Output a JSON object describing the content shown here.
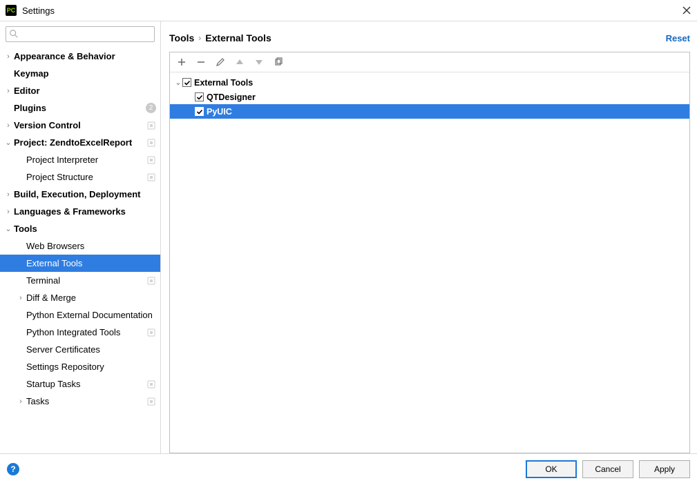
{
  "titlebar": {
    "title": "Settings"
  },
  "search": {
    "placeholder": ""
  },
  "sidebar": {
    "items": [
      {
        "label": "Appearance & Behavior",
        "bold": true,
        "arrow": "›",
        "indent": 0
      },
      {
        "label": "Keymap",
        "bold": true,
        "arrow": "",
        "indent": 0
      },
      {
        "label": "Editor",
        "bold": true,
        "arrow": "›",
        "indent": 0
      },
      {
        "label": "Plugins",
        "bold": true,
        "arrow": "",
        "indent": 0,
        "badge": "2"
      },
      {
        "label": "Version Control",
        "bold": true,
        "arrow": "›",
        "indent": 0,
        "cfg": true
      },
      {
        "label": "Project: ZendtoExcelReport",
        "bold": true,
        "arrow": "⌄",
        "indent": 0,
        "cfg": true
      },
      {
        "label": "Project Interpreter",
        "bold": false,
        "arrow": "",
        "indent": 1,
        "cfg": true
      },
      {
        "label": "Project Structure",
        "bold": false,
        "arrow": "",
        "indent": 1,
        "cfg": true
      },
      {
        "label": "Build, Execution, Deployment",
        "bold": true,
        "arrow": "›",
        "indent": 0
      },
      {
        "label": "Languages & Frameworks",
        "bold": true,
        "arrow": "›",
        "indent": 0
      },
      {
        "label": "Tools",
        "bold": true,
        "arrow": "⌄",
        "indent": 0
      },
      {
        "label": "Web Browsers",
        "bold": false,
        "arrow": "",
        "indent": 1
      },
      {
        "label": "External Tools",
        "bold": false,
        "arrow": "",
        "indent": 1,
        "selected": true
      },
      {
        "label": "Terminal",
        "bold": false,
        "arrow": "",
        "indent": 1,
        "cfg": true
      },
      {
        "label": "Diff & Merge",
        "bold": false,
        "arrow": "›",
        "indent": 1
      },
      {
        "label": "Python External Documentation",
        "bold": false,
        "arrow": "",
        "indent": 1
      },
      {
        "label": "Python Integrated Tools",
        "bold": false,
        "arrow": "",
        "indent": 1,
        "cfg": true
      },
      {
        "label": "Server Certificates",
        "bold": false,
        "arrow": "",
        "indent": 1
      },
      {
        "label": "Settings Repository",
        "bold": false,
        "arrow": "",
        "indent": 1
      },
      {
        "label": "Startup Tasks",
        "bold": false,
        "arrow": "",
        "indent": 1,
        "cfg": true
      },
      {
        "label": "Tasks",
        "bold": false,
        "arrow": "›",
        "indent": 1,
        "cfg": true
      }
    ]
  },
  "breadcrumb": {
    "part1": "Tools",
    "part2": "External Tools"
  },
  "reset_label": "Reset",
  "content": {
    "rows": [
      {
        "label": "External Tools",
        "depth": 0,
        "bold": true,
        "arrow": "⌄",
        "checked": true
      },
      {
        "label": "QTDesigner",
        "depth": 1,
        "bold": true,
        "arrow": "",
        "checked": true
      },
      {
        "label": "PyUIC",
        "depth": 1,
        "bold": true,
        "arrow": "",
        "checked": true,
        "selected": true
      }
    ]
  },
  "footer": {
    "help": "?",
    "ok": "OK",
    "cancel": "Cancel",
    "apply": "Apply"
  }
}
